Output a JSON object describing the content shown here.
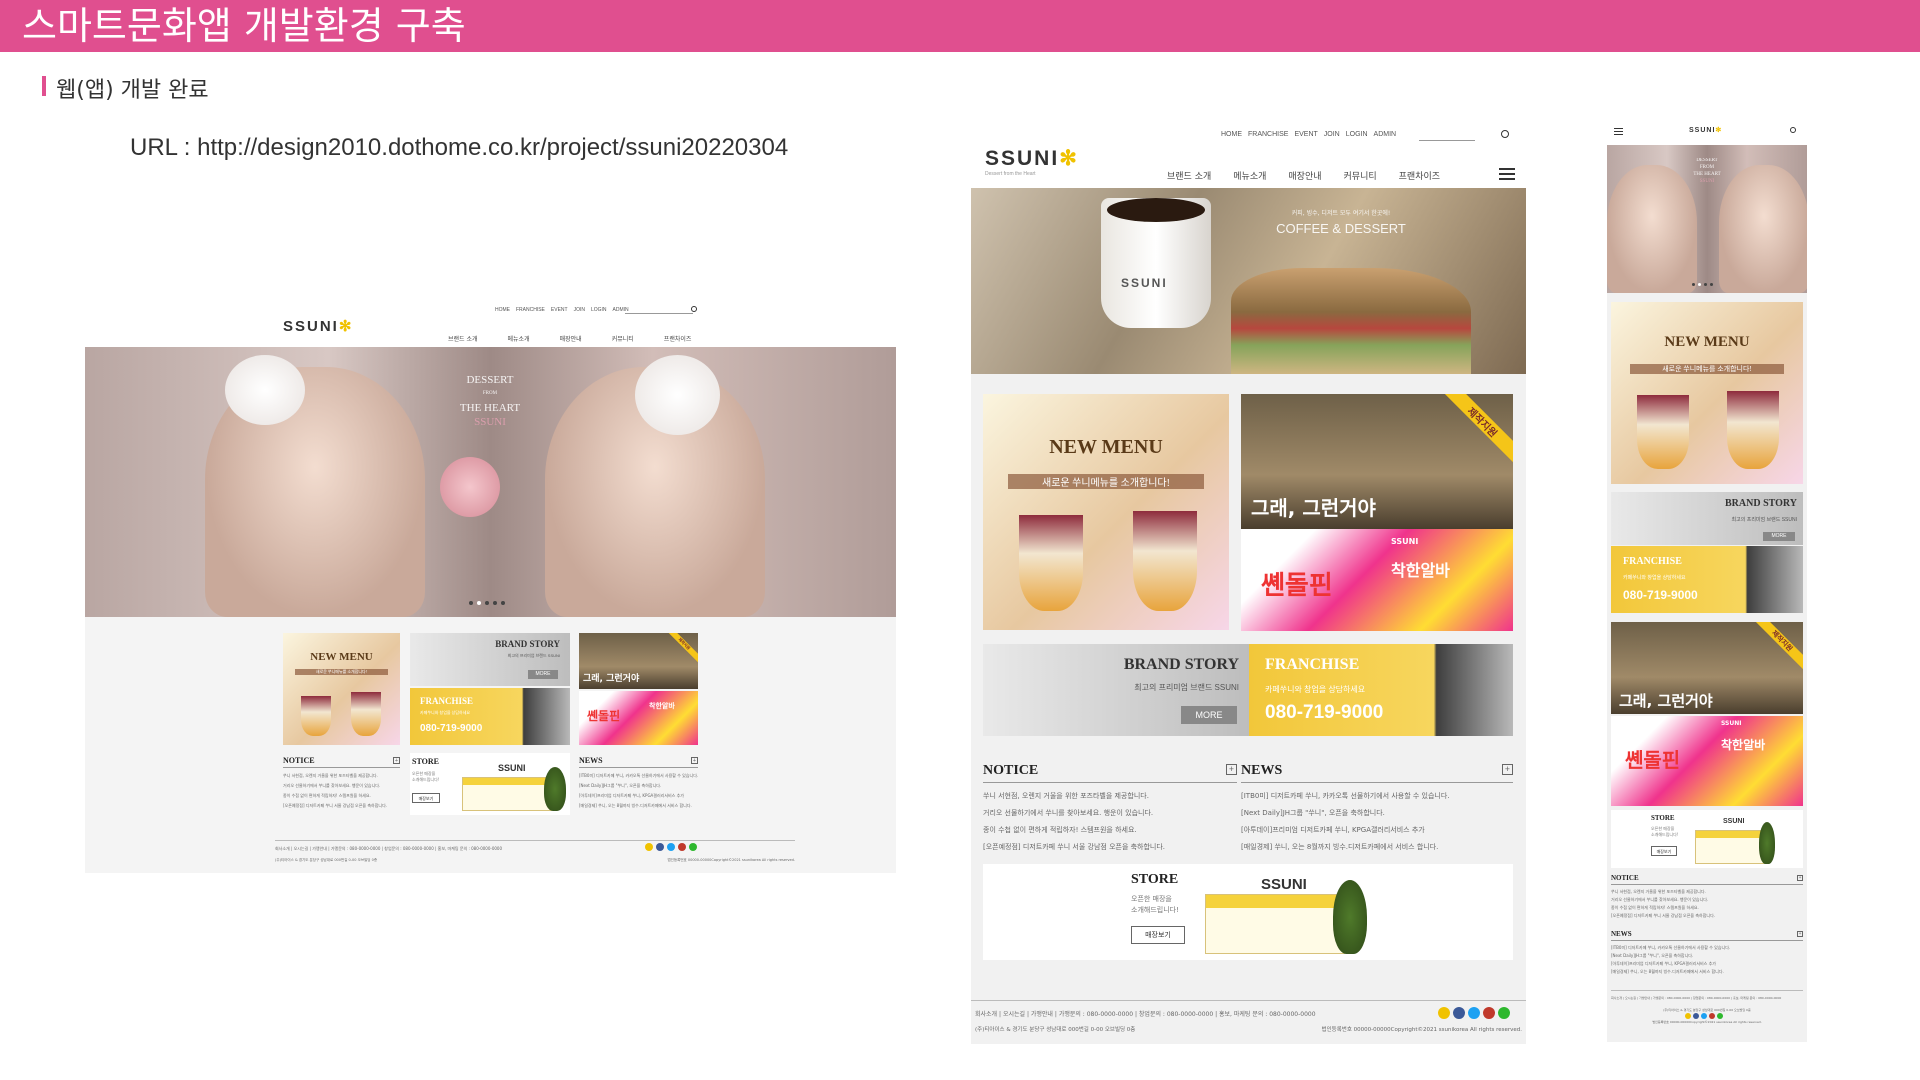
{
  "slide": {
    "title": "스마트문화앱 개발환경 구축",
    "section_label": "웹(앱) 개발 완료",
    "url": "URL : http://design2010.dothome.co.kr/project/ssuni20220304"
  },
  "colors": {
    "accent": "#e04f8f",
    "brand_yellow": "#f0c200"
  },
  "site": {
    "logo": "SSUNI",
    "logo_tagline": "Dessert from the Heart",
    "util_menu": [
      "HOME",
      "FRANCHISE",
      "EVENT",
      "JOIN",
      "LOGIN",
      "ADMIN"
    ],
    "gnb": [
      "브랜드 소개",
      "메뉴소개",
      "매장안내",
      "커뮤니티",
      "프랜차이즈"
    ],
    "hero_desktop": {
      "line1": "DESSERT",
      "line2": "FROM",
      "line3": "THE HEART",
      "line4": "SSUNI"
    },
    "hero_tablet": {
      "sub": "커피, 빙수, 디저트 모두 여기서 한곳에!",
      "title": "COFFEE & DESSERT",
      "cup_logo": "SSUNI"
    },
    "new_menu": {
      "title": "NEW MENU",
      "sub": "새로운 쑤니메뉴를 소개합니다!"
    },
    "brand_story": {
      "title": "BRAND STORY",
      "sub": "최고의 프리미엄 브랜드 SSUNI",
      "more": "MORE"
    },
    "franchise": {
      "title": "FRANCHISE",
      "sub": "카페쑤니와 창업을 상담하세요",
      "phone": "080-719-9000"
    },
    "drama": {
      "ribbon": "제작지원",
      "title": "그래, 그런거야"
    },
    "ad": {
      "title": "쏀돌핀",
      "badge": "착한알바",
      "brand": "SSUNI"
    },
    "notice": {
      "title": "NOTICE",
      "items": [
        "쑤니 서현점, 오렌지 거울을 위한 포즈타벨을 제공합니다.",
        "거리오 선물하기에서 쑤니를 찾아보세요. 행운이 있습니다.",
        "종이 수첩 없이 편하게 적립하자! 스템프원을 하세요.",
        "[오픈예정점] 디저트카페 쑤니 서울 강남점 오픈을 축하합니다."
      ]
    },
    "news": {
      "title": "NEWS",
      "items": [
        "[ITB0미] 디저트카페 쑤니, 카카오톡 선물하기에서 사용할 수 있습니다.",
        "[Next Daily]JH그룹 \"쑤니\", 오픈을 축하합니다.",
        "[아투데이]프리미엄 디저트카페 쑤니, KPGA갤러리서비스 추가",
        "[매일경제] 쑤니, 오는 8월까지 빙수.디저트카페에서 서비스 합니다."
      ]
    },
    "store": {
      "title": "STORE",
      "sub1": "오픈한 매장을",
      "sub2": "소개해드립니다!",
      "button": "매장보기",
      "sign": "SSUNI"
    },
    "footer": {
      "links": [
        "회사소개",
        "오시는길",
        "가맹안내",
        "가맹문의 : 080-0000-0000",
        "창업문의 : 080-0000-0000",
        "홍보, 마케팅 문의 : 080-0000-0000"
      ],
      "address": "(주)티아이스 & 경기도 분당구 성남대로 000번길 0-00 오브빌딩 0층",
      "copyright": "법인등록번호 00000-00000Copyright©2021 ssunikorea All rights reserved."
    },
    "sns_colors": [
      "#f0c200",
      "#3b5998",
      "#1da1f2",
      "#c0392b",
      "#2eb82e"
    ]
  }
}
